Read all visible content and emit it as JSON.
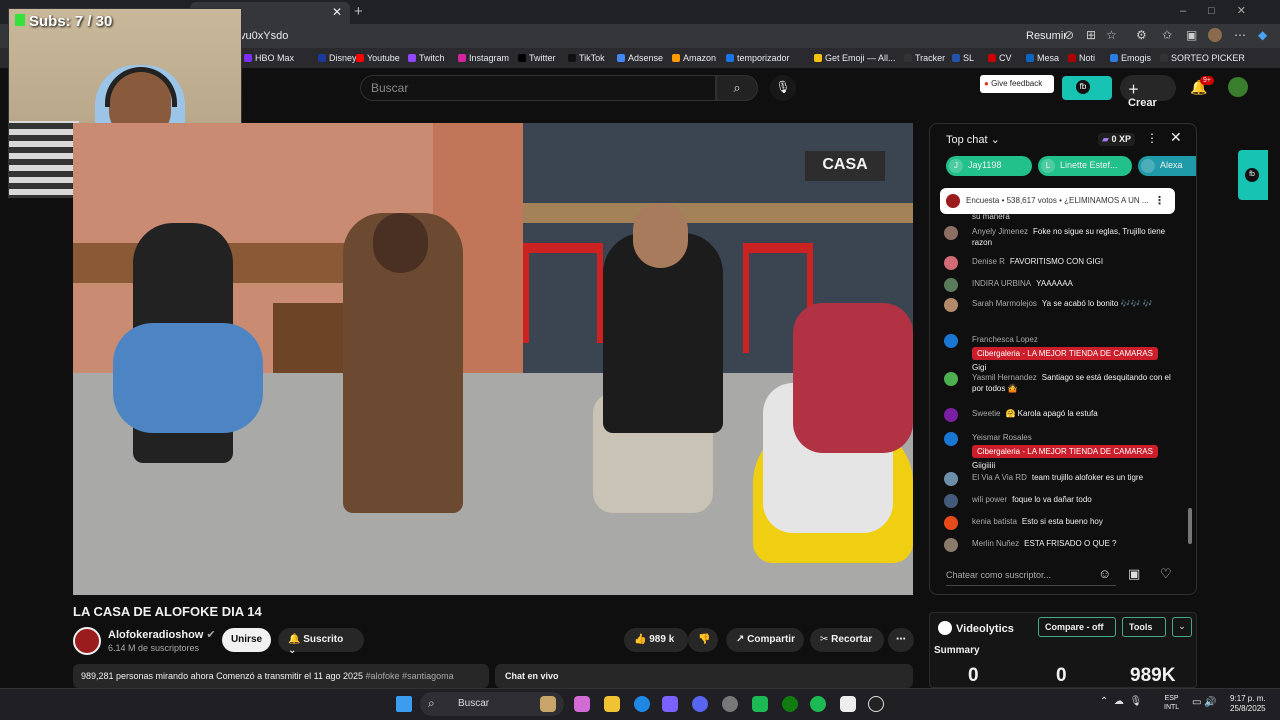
{
  "browser": {
    "tab_title": "n",
    "url": "vu0xYsdo",
    "resume_label": "Resumir",
    "bookmarks": [
      "HBO Max",
      "Disney+",
      "Youtube",
      "Twitch",
      "Instagram",
      "Twitter",
      "TikTok",
      "Adsense",
      "Amazon",
      "temporizador",
      "Get Emoji — All...",
      "Tracker",
      "SL",
      "CV",
      "Mesa",
      "Noti",
      "Emogis",
      "SORTEO PICKER"
    ],
    "bookmark_colors": [
      "#7b2ff7",
      "#1b3a9b",
      "#ff0000",
      "#9146ff",
      "#d6249f",
      "#000000",
      "#111111",
      "#4285f4",
      "#ff9900",
      "#1a73e8",
      "#f4c20d",
      "#333333",
      "#2255aa",
      "#cc0000",
      "#0a66c2",
      "#b00000",
      "#2a7de1",
      "#333333"
    ]
  },
  "webcam": {
    "subs_label": "Subs: 7 / 30"
  },
  "header": {
    "search_placeholder": "Buscar",
    "feedback_label": "Give feedback",
    "create_label": "Crear",
    "notification_badge": "9+"
  },
  "video": {
    "title": "LA CASA DE ALOFOKE DIA 14",
    "overlay_logo": "CASA",
    "channel_name": "Alofokeradioshow",
    "subscribers": "6.14 M de suscriptores",
    "join_label": "Unirse",
    "subscribed_label": "Suscrito",
    "likes": "989 k",
    "share_label": "Compartir",
    "clip_label": "Recortar",
    "description_line": "989,281 personas mirando ahora  Comenzó a transmitir el 11 ago 2025",
    "description_tags": "#alofoke #santiagoma",
    "live_chat_label": "Chat en vivo"
  },
  "chat": {
    "title": "Top chat",
    "xp_label": "0 XP",
    "donors": [
      {
        "name": "Jay1198",
        "initial": "J",
        "color": "#22c08a"
      },
      {
        "name": "Linette Estef...",
        "initial": "L",
        "color": "#22c08a"
      },
      {
        "name": "Alexa",
        "initial": "",
        "color": "#1e9aa8"
      }
    ],
    "poll_text": "Encuesta • 538,617 votos • ¿ELIMINAMOS A UN ...",
    "partial_text": "su manera",
    "messages": [
      {
        "author": "Anyely Jimenez",
        "text": "Foke no sigue su reglas, Trujillo tiene razon",
        "avatar_color": "#8d6e63",
        "banner": ""
      },
      {
        "author": "Denise R",
        "text": "FAVORITISMO CON GIGI",
        "avatar_color": "#d16b74",
        "banner": ""
      },
      {
        "author": "INDIRA URBINA",
        "text": "YAAAAAA",
        "avatar_color": "#5a7b5a",
        "banner": ""
      },
      {
        "author": "Sarah Marmolejos",
        "text": "Ya se acabó lo bonito 🎶🎶 🎶",
        "avatar_color": "#b58a6a",
        "banner": ""
      },
      {
        "author": "Franchesca Lopez",
        "text": "Gigi",
        "avatar_color": "#1976d2",
        "banner": "Cibergaleria - LA MEJOR TIENDA DE CAMARAS"
      },
      {
        "author": "Yasmil Hernandez",
        "text": "Santiago se está desquitando con el por todos 🤷",
        "avatar_color": "#4caf50",
        "banner": ""
      },
      {
        "author": "Sweetie",
        "text": "🤗 Karola apagó la estufa",
        "avatar_color": "#7b1fa2",
        "banner": ""
      },
      {
        "author": "Yeismar Rosales",
        "text": "Giigiiiii",
        "avatar_color": "#1976d2",
        "banner": "Cibergaleria - LA MEJOR TIENDA DE CAMARAS"
      },
      {
        "author": "El Via A Via RD",
        "text": "team trujillo alofoker es un tigre",
        "avatar_color": "#6d8ea8",
        "banner": ""
      },
      {
        "author": "wili power",
        "text": "foque lo va dañar todo",
        "avatar_color": "#445a7a",
        "banner": ""
      },
      {
        "author": "kenia batista",
        "text": "Esto si esta bueno hoy",
        "avatar_color": "#e64a19",
        "banner": ""
      },
      {
        "author": "Merlin Nuñez",
        "text": "ESTA FRISADO O QUE ?",
        "avatar_color": "#8a7a6a",
        "banner": ""
      }
    ],
    "input_placeholder": "Chatear como suscriptor..."
  },
  "videolytics": {
    "title": "Videolytics",
    "compare_label": "Compare - off",
    "tools_label": "Tools",
    "summary_label": "Summary",
    "values": [
      "0",
      "0",
      "989K"
    ]
  },
  "taskbar": {
    "search_label": "Buscar",
    "lang": "ESP",
    "lang2": "INTL",
    "time": "9:17 p. m.",
    "date": "25/8/2025"
  },
  "colors": {
    "accent": "#17c3b2",
    "youtube_red": "#ff0000",
    "banner_red": "#cc1d2a"
  }
}
